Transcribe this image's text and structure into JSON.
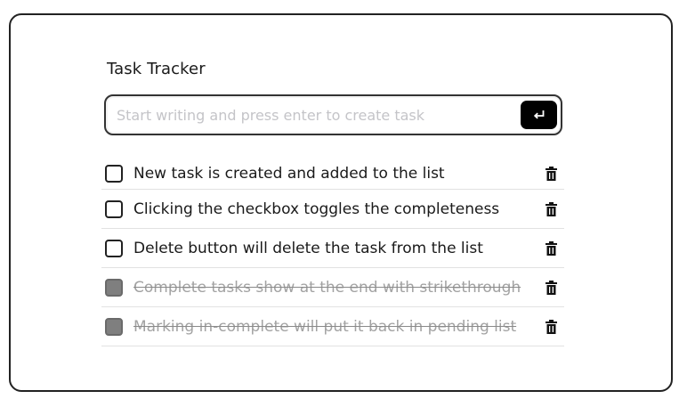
{
  "app": {
    "title": "Task Tracker"
  },
  "input": {
    "placeholder": "Start writing and press enter to create task",
    "value": ""
  },
  "tasks": [
    {
      "text": "New task is created and added to the list",
      "completed": false
    },
    {
      "text": "Clicking the checkbox toggles the completeness",
      "completed": false
    },
    {
      "text": "Delete button will delete the task from the list",
      "completed": false
    },
    {
      "text": "Complete tasks show at the end with strikethrough",
      "completed": true
    },
    {
      "text": "Marking in-complete will put it back in pending list",
      "completed": true
    }
  ],
  "icons": {
    "submit": "enter-return-icon",
    "delete": "trash-icon"
  },
  "colors": {
    "completed_checkbox": "#7f7f7f",
    "completed_text": "#a2a2a2",
    "button_bg": "#000000"
  }
}
